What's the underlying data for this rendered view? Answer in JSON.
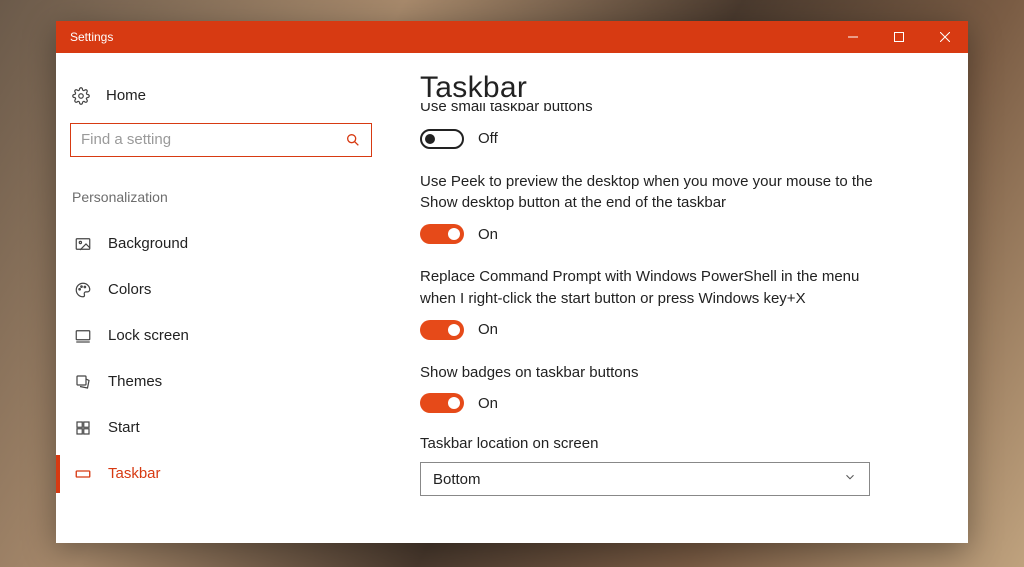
{
  "window": {
    "title": "Settings"
  },
  "sidebar": {
    "home": "Home",
    "search_placeholder": "Find a setting",
    "section": "Personalization",
    "items": [
      {
        "label": "Background"
      },
      {
        "label": "Colors"
      },
      {
        "label": "Lock screen"
      },
      {
        "label": "Themes"
      },
      {
        "label": "Start"
      },
      {
        "label": "Taskbar"
      }
    ]
  },
  "content": {
    "title": "Taskbar",
    "clipped_prev_label": "Use small taskbar buttons",
    "settings": [
      {
        "desc": "",
        "state": "off",
        "state_label": "Off"
      },
      {
        "desc": "Use Peek to preview the desktop when you move your mouse to the Show desktop button at the end of the taskbar",
        "state": "on",
        "state_label": "On"
      },
      {
        "desc": "Replace Command Prompt with Windows PowerShell in the menu when I right-click the start button or press Windows key+X",
        "state": "on",
        "state_label": "On"
      },
      {
        "desc": "Show badges on taskbar buttons",
        "state": "on",
        "state_label": "On"
      }
    ],
    "location": {
      "label": "Taskbar location on screen",
      "value": "Bottom"
    }
  }
}
